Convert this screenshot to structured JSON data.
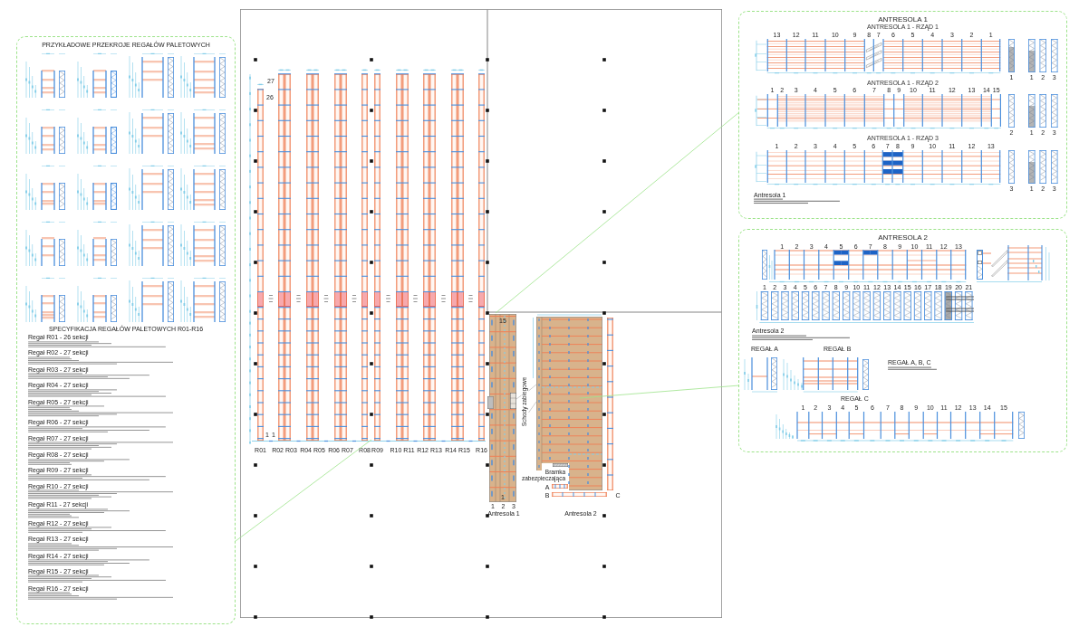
{
  "sections_sheet": {
    "title": "PRZYKŁADOWE PRZEKROJE REGAŁÓW PALETOWYCH",
    "spec_title": "SPECYFIKACJA REGAŁÓW PALETOWYCH R01-R16",
    "spec_blocks": [
      {
        "heading": "Regał R01 - 26 sekcji"
      },
      {
        "heading": "Regał R02 - 27 sekcji"
      },
      {
        "heading": "Regał R03 - 27 sekcji"
      },
      {
        "heading": "Regał R04 - 27 sekcji"
      },
      {
        "heading": "Regał R05 - 27 sekcji"
      },
      {
        "heading": "Regał R06 - 27 sekcji"
      },
      {
        "heading": "Regał R07 - 27 sekcji"
      },
      {
        "heading": "Regał R08 - 27 sekcji"
      },
      {
        "heading": "Regał R09 - 27 sekcji"
      },
      {
        "heading": "Regał R10 - 27 sekcji"
      },
      {
        "heading": "Regał R11 - 27 sekcji"
      },
      {
        "heading": "Regał R12 - 27 sekcji"
      },
      {
        "heading": "Regał R13 - 27 sekcji"
      },
      {
        "heading": "Regał R14 - 27 sekcji"
      },
      {
        "heading": "Regał R15 - 27 sekcji"
      },
      {
        "heading": "Regał R16 - 27 sekcji"
      }
    ]
  },
  "plan": {
    "racks": [
      {
        "label": "R01",
        "kind": "single"
      },
      {
        "label": "R02 R03",
        "kind": "double"
      },
      {
        "label": "R04 R05",
        "kind": "double"
      },
      {
        "label": "R06 R07",
        "kind": "double"
      },
      {
        "label": "R08",
        "kind": "single"
      },
      {
        "label": "R09",
        "kind": "single"
      },
      {
        "label": "R10 R11",
        "kind": "double"
      },
      {
        "label": "R12 R13",
        "kind": "double"
      },
      {
        "label": "R14 R15",
        "kind": "double"
      },
      {
        "label": "R16",
        "kind": "single"
      }
    ],
    "section_counts": [
      "27",
      "26"
    ],
    "end_marks": [
      "1",
      "1"
    ],
    "mezzanines": [
      {
        "label": "Antresola 1",
        "top_mark": "15",
        "bottom_mark": "1",
        "column_labels": [
          "1",
          "2",
          "3"
        ]
      },
      {
        "label": "Antresola 2"
      }
    ],
    "small_racks": [
      {
        "label": "A"
      },
      {
        "label": "B"
      },
      {
        "label": "C"
      }
    ],
    "stairs_label": "Schody zabiegowe",
    "gate_label": "Bramka zabezpieczająca"
  },
  "antresola_1": {
    "title": "ANTRESOLA 1",
    "rows": [
      {
        "title": "ANTRESOLA 1 - RZĄD 1",
        "bays": [
          "13",
          "12",
          "11",
          "10",
          "9",
          "8",
          "7",
          "6",
          "5",
          "4",
          "3",
          "2",
          "1"
        ],
        "frame_label": "1",
        "frame_labels": [
          "1",
          "2",
          "3"
        ]
      },
      {
        "title": "ANTRESOLA 1 - RZĄD 2",
        "bays": [
          "1",
          "2",
          "3",
          "4",
          "5",
          "6",
          "7",
          "8",
          "9",
          "10",
          "11",
          "12",
          "13",
          "14",
          "15"
        ],
        "frame_label": "2",
        "frame_labels": [
          "1",
          "2",
          "3"
        ]
      },
      {
        "title": "ANTRESOLA 1 - RZĄD 3",
        "bays": [
          "1",
          "2",
          "3",
          "4",
          "5",
          "6",
          "7",
          "8",
          "9",
          "10",
          "11",
          "12",
          "13"
        ],
        "frame_label": "3",
        "frame_labels": [
          "1",
          "2",
          "3"
        ]
      }
    ],
    "notes_heading": "Antresola 1"
  },
  "antresola_2": {
    "title": "ANTRESOLA 2",
    "front_bays": [
      "1",
      "2",
      "3",
      "4",
      "5",
      "6",
      "7",
      "8",
      "9",
      "10",
      "11",
      "12",
      "13"
    ],
    "frame_bays": [
      "1",
      "2",
      "3",
      "4",
      "5",
      "6",
      "7",
      "8",
      "9",
      "10",
      "11",
      "12",
      "13",
      "14",
      "15",
      "16",
      "17",
      "18",
      "19",
      "20",
      "21"
    ],
    "notes_heading": "Antresola 2",
    "regal_a_title": "REGAŁ A",
    "regal_b_title": "REGAŁ B",
    "regal_notes_heading": "REGAŁ A, B, C",
    "regal_c": {
      "title": "REGAŁ C",
      "bays": [
        "1",
        "2",
        "3",
        "4",
        "5",
        "6",
        "7",
        "8",
        "9",
        "10",
        "11",
        "12",
        "13",
        "14",
        "15"
      ]
    }
  }
}
